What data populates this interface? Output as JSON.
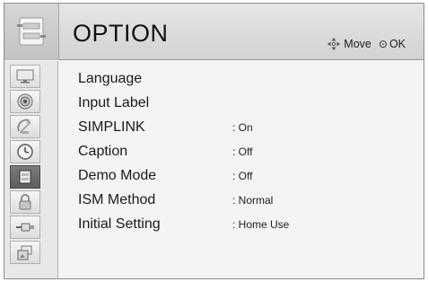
{
  "header": {
    "title": "OPTION",
    "hint_move": "Move",
    "hint_ok": "OK"
  },
  "sidebar": {
    "items": [
      {
        "icon": "picture-icon"
      },
      {
        "icon": "audio-icon"
      },
      {
        "icon": "channel-icon"
      },
      {
        "icon": "time-icon"
      },
      {
        "icon": "option-icon",
        "active": true
      },
      {
        "icon": "lock-icon"
      },
      {
        "icon": "input-icon"
      },
      {
        "icon": "my-media-icon"
      }
    ]
  },
  "menu": {
    "items": [
      {
        "label": "Language",
        "value": ""
      },
      {
        "label": "Input Label",
        "value": ""
      },
      {
        "label": "SIMPLINK",
        "value": ": On"
      },
      {
        "label": "Caption",
        "value": ": Off"
      },
      {
        "label": "Demo Mode",
        "value": ": Off"
      },
      {
        "label": "ISM Method",
        "value": ": Normal"
      },
      {
        "label": "Initial Setting",
        "value": ": Home Use"
      }
    ]
  }
}
